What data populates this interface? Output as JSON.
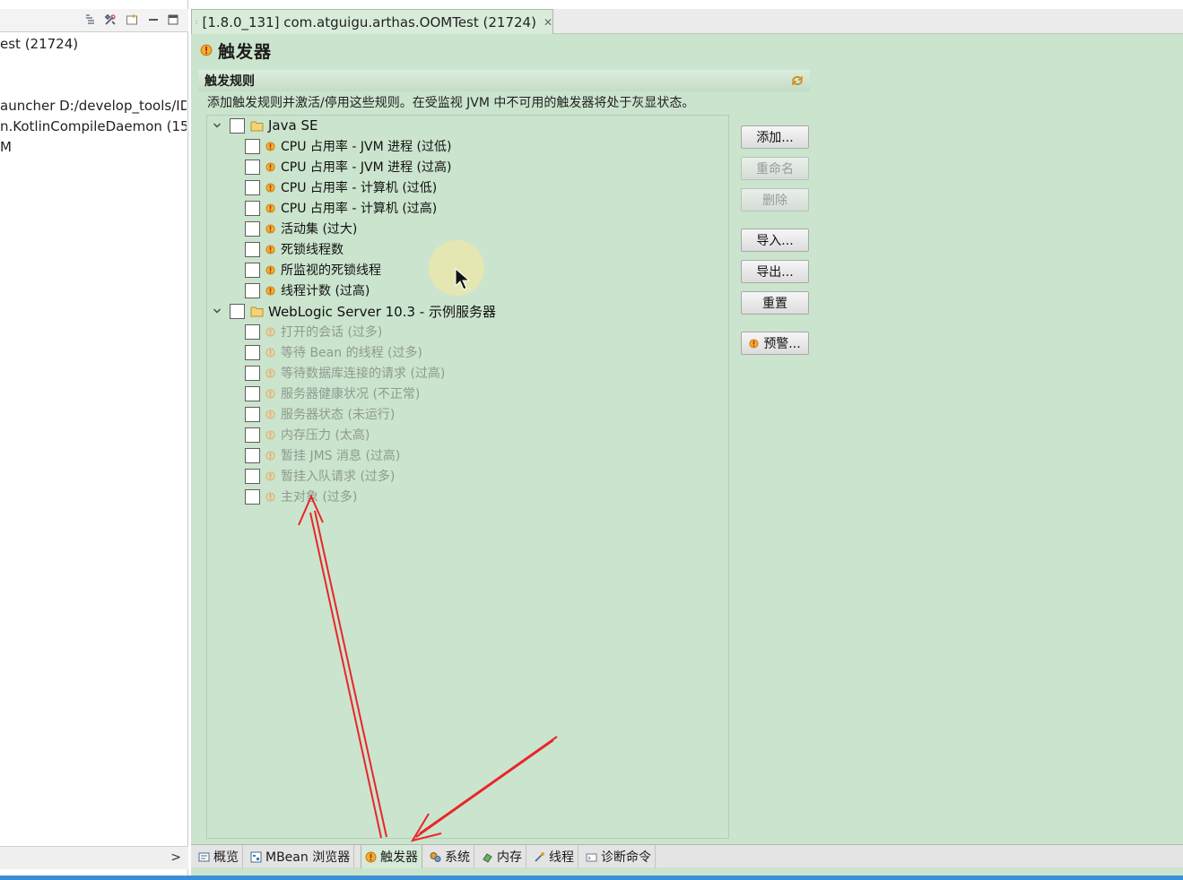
{
  "left_panel": {
    "items": [
      "est (21724)",
      "auncher D:/develop_tools/ID",
      "n.KotlinCompileDaemon (15",
      "M"
    ],
    "scroll_glyph": ">"
  },
  "editor_tab": {
    "title": "[1.8.0_131] com.atguigu.arthas.OOMTest (21724)",
    "close_glyph": "✕"
  },
  "page": {
    "title": "触发器"
  },
  "section": {
    "title": "触发规则",
    "description": "添加触发规则并激活/停用这些规则。在受监视 JVM 中不可用的触发器将处于灰显状态。"
  },
  "tree": {
    "groups": [
      {
        "label": "Java SE",
        "enabled": true,
        "items": [
          "CPU 占用率 - JVM 进程 (过低)",
          "CPU 占用率 - JVM 进程 (过高)",
          "CPU 占用率 - 计算机 (过低)",
          "CPU 占用率 - 计算机 (过高)",
          "活动集 (过大)",
          "死锁线程数",
          "所监视的死锁线程",
          "线程计数 (过高)"
        ]
      },
      {
        "label": "WebLogic Server 10.3 - 示例服务器",
        "enabled": false,
        "items": [
          "打开的会话 (过多)",
          "等待 Bean 的线程 (过多)",
          "等待数据库连接的请求 (过高)",
          "服务器健康状况 (不正常)",
          "服务器状态 (未运行)",
          "内存压力 (太高)",
          "暂挂 JMS 消息 (过高)",
          "暂挂入队请求 (过多)",
          "主对象 (过多)"
        ]
      }
    ]
  },
  "buttons": {
    "add": "添加...",
    "rename": "重命名",
    "delete": "删除",
    "import": "导入...",
    "export": "导出...",
    "reset": "重置",
    "alerts": "预警..."
  },
  "bottom_tabs": [
    {
      "label": "概览",
      "icon": "overview-icon"
    },
    {
      "label": "MBean 浏览器",
      "icon": "mbean-browser-icon"
    },
    {
      "label": "触发器",
      "icon": "trigger-icon"
    },
    {
      "label": "系统",
      "icon": "system-icon"
    },
    {
      "label": "内存",
      "icon": "memory-icon"
    },
    {
      "label": "线程",
      "icon": "thread-icon"
    },
    {
      "label": "诊断命令",
      "icon": "diagnostic-icon"
    }
  ],
  "colors": {
    "panel_green": "#cbe4cd",
    "warning_orange": "#e88a12",
    "annotation_red": "#e8262a"
  }
}
